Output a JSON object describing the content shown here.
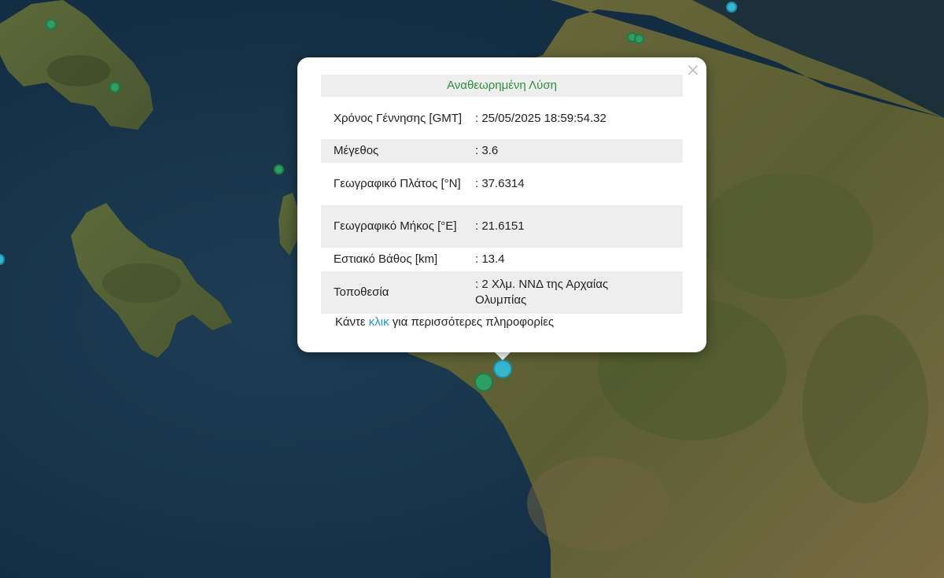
{
  "map": {
    "markers": [
      {
        "id": "eq-1",
        "color": "green"
      },
      {
        "id": "eq-2",
        "color": "green"
      },
      {
        "id": "eq-3",
        "color": "green"
      },
      {
        "id": "eq-4",
        "color": "green"
      },
      {
        "id": "eq-5",
        "color": "green"
      },
      {
        "id": "eq-6",
        "color": "cyan"
      },
      {
        "id": "eq-7",
        "color": "cyan"
      },
      {
        "id": "eq-8",
        "color": "green"
      },
      {
        "id": "eq-selected",
        "color": "cyan"
      }
    ]
  },
  "popup": {
    "close_icon": "×",
    "header": "Αναθεωρημένη Λύση",
    "rows": [
      {
        "label": "Χρόνος Γέννησης [GMT]",
        "value": ": 25/05/2025 18:59:54.32"
      },
      {
        "label": "Μέγεθος",
        "value": ": 3.6"
      },
      {
        "label": "Γεωγραφικό Πλάτος [°N]",
        "value": ": 37.6314"
      },
      {
        "label": "Γεωγραφικό Μήκος [°E]",
        "value": ": 21.6151"
      },
      {
        "label": "Εστιακό Βάθος [km]",
        "value": ": 13.4"
      },
      {
        "label": "Τοποθεσία",
        "value": ": 2 Χλμ. ΝΝΔ της Αρχαίας Ολυμπίας"
      }
    ],
    "footer_prefix": "Κάντε ",
    "footer_link": "κλικ",
    "footer_suffix": " για περισσότερες πληροφορίες"
  },
  "colors": {
    "sea": "#173247",
    "land": "#5e5f35",
    "marker_green": "#2e9e62",
    "marker_cyan": "#36b6cf",
    "header_text": "#2f8f3a",
    "link": "#2a8fc9"
  }
}
